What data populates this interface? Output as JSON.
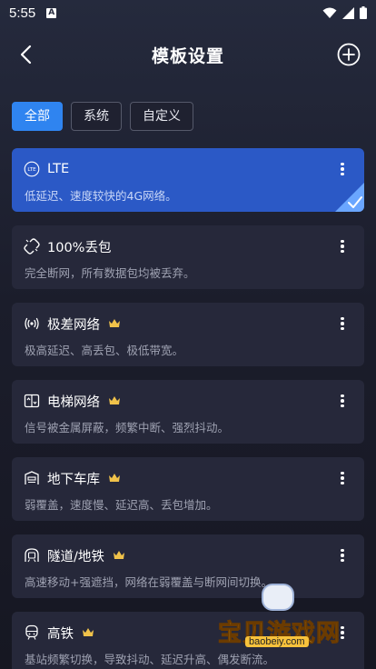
{
  "status_bar": {
    "time": "5:55",
    "a_label": "A"
  },
  "header": {
    "title": "模板设置"
  },
  "tabs": [
    {
      "label": "全部",
      "active": true
    },
    {
      "label": "系统",
      "active": false
    },
    {
      "label": "自定义",
      "active": false
    }
  ],
  "templates": [
    {
      "icon": "lte-icon",
      "title": "LTE",
      "desc": "低延迟、速度较快的4G网络。",
      "premium": false,
      "selected": true
    },
    {
      "icon": "broken-link-icon",
      "title": "100%丢包",
      "desc": "完全断网，所有数据包均被丢弃。",
      "premium": false,
      "selected": false
    },
    {
      "icon": "signal-waves-icon",
      "title": "极差网络",
      "desc": "极高延迟、高丢包、极低带宽。",
      "premium": true,
      "selected": false
    },
    {
      "icon": "elevator-icon",
      "title": "电梯网络",
      "desc": "信号被金属屏蔽，频繁中断、强烈抖动。",
      "premium": true,
      "selected": false
    },
    {
      "icon": "garage-icon",
      "title": "地下车库",
      "desc": "弱覆盖，速度慢、延迟高、丢包增加。",
      "premium": true,
      "selected": false
    },
    {
      "icon": "metro-icon",
      "title": "隧道/地铁",
      "desc": "高速移动+强遮挡，网络在弱覆盖与断网间切换。",
      "premium": true,
      "selected": false
    },
    {
      "icon": "train-icon",
      "title": "高铁",
      "desc": "基站频繁切换，导致抖动、延迟升高、偶发断流。",
      "premium": true,
      "selected": false
    }
  ],
  "watermark": {
    "text": "宝贝游戏网",
    "url": "baobeiy.com"
  },
  "colors": {
    "accent": "#2f84f0",
    "selected_card": "#2b59c6",
    "card": "#26283a",
    "crown": "#f0c24a"
  }
}
